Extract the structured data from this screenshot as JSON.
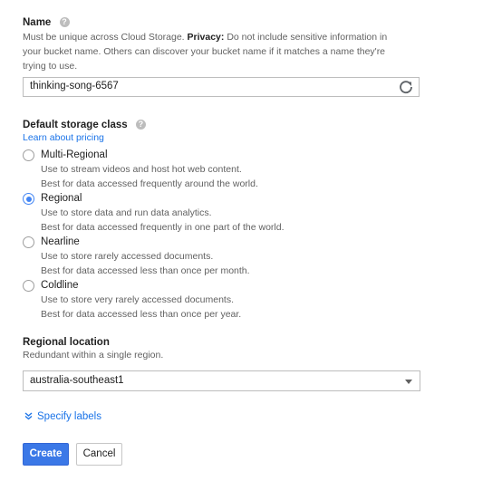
{
  "name_section": {
    "title": "Name",
    "help_icon": "help-circle-icon",
    "desc_prefix": "Must be unique across Cloud Storage. ",
    "privacy_label": "Privacy:",
    "desc_line1_rest": " Do not include sensitive information in",
    "desc_line2": "your bucket name. Others can discover your bucket name if it matches a name they're",
    "desc_line3": "trying to use.",
    "input_value": "thinking-song-6567",
    "refresh_icon": "refresh-icon"
  },
  "storage_class": {
    "title": "Default storage class",
    "help_icon": "help-circle-icon",
    "learn_link": "Learn about pricing",
    "selected": "Regional",
    "options": [
      {
        "label": "Multi-Regional",
        "line1": "Use to stream videos and host hot web content.",
        "line2": "Best for data accessed frequently around the world.",
        "checked": false
      },
      {
        "label": "Regional",
        "line1": "Use to store data and run data analytics.",
        "line2": "Best for data accessed frequently in one part of the world.",
        "checked": true
      },
      {
        "label": "Nearline",
        "line1": "Use to store rarely accessed documents.",
        "line2": "Best for data accessed less than once per month.",
        "checked": false
      },
      {
        "label": "Coldline",
        "line1": "Use to store very rarely accessed documents.",
        "line2": "Best for data accessed less than once per year.",
        "checked": false
      }
    ]
  },
  "location": {
    "title": "Regional location",
    "desc": "Redundant within a single region.",
    "selected": "australia-southeast1",
    "caret_icon": "dropdown-caret-icon"
  },
  "labels": {
    "text": "Specify labels",
    "icon": "chevron-double-down-icon"
  },
  "actions": {
    "create": "Create",
    "cancel": "Cancel"
  },
  "colors": {
    "accent": "#4285f4",
    "link": "#1a73e8",
    "primary_button": "#3b78e7"
  }
}
